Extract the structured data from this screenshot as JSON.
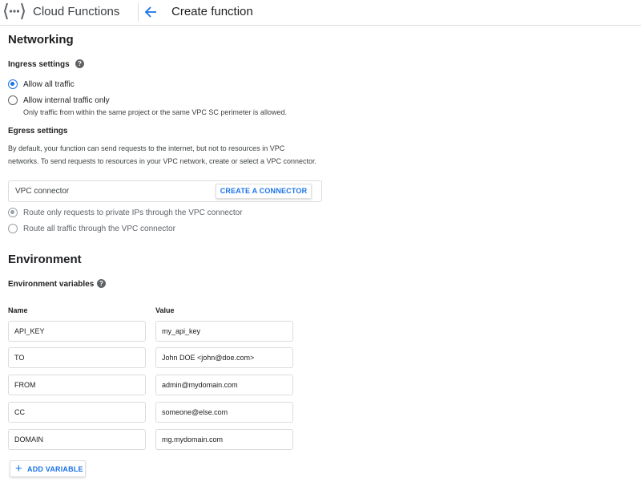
{
  "header": {
    "app_title": "Cloud Functions",
    "page_title": "Create function"
  },
  "networking": {
    "title": "Networking",
    "ingress": {
      "label": "Ingress settings",
      "options": [
        {
          "label": "Allow all traffic",
          "selected": true
        },
        {
          "label": "Allow internal traffic only",
          "selected": false
        }
      ],
      "internal_note": "Only traffic from within the same project or the same VPC SC perimeter is allowed."
    },
    "egress": {
      "label": "Egress settings",
      "description_line1": "By default, your function can send requests to the internet, but not to resources in VPC",
      "description_line2": "networks. To send requests to resources in your VPC network, create or select a VPC connector.",
      "vpc_connector_label": "VPC connector",
      "create_connector_label": "CREATE A CONNECTOR",
      "route_options": [
        {
          "label": "Route only requests to private IPs through the VPC connector",
          "selected": true
        },
        {
          "label": "Route all traffic through the VPC connector",
          "selected": false
        }
      ]
    }
  },
  "environment": {
    "title": "Environment",
    "variables_label": "Environment variables",
    "name_header": "Name",
    "value_header": "Value",
    "variables": [
      {
        "name": "API_KEY",
        "value": "my_api_key"
      },
      {
        "name": "TO",
        "value": "John DOE <john@doe.com>"
      },
      {
        "name": "FROM",
        "value": "admin@mydomain.com"
      },
      {
        "name": "CC",
        "value": "someone@else.com"
      },
      {
        "name": "DOMAIN",
        "value": "mg.mydomain.com"
      }
    ],
    "add_variable_label": "ADD VARIABLE"
  },
  "colors": {
    "accent": "#1a73e8",
    "border": "#dadce0",
    "text": "#202124",
    "secondary_text": "#5f6368"
  },
  "icons": {
    "logo": "cloud-functions-logo-icon",
    "back": "arrow-back-icon",
    "help": "help-circle-icon",
    "add": "plus-icon"
  }
}
